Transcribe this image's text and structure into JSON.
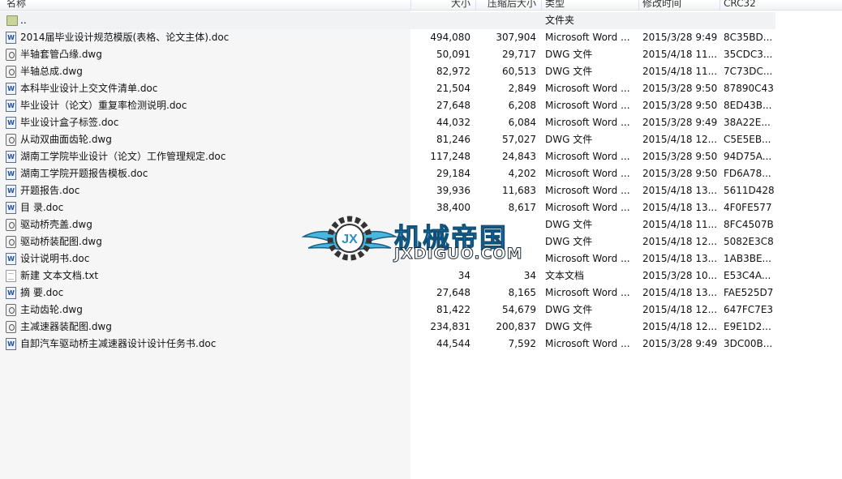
{
  "columns": {
    "name": "名称",
    "size": "大小",
    "packed": "压缩后大小",
    "type": "类型",
    "modified": "修改时间",
    "crc": "CRC32"
  },
  "parent_row": {
    "name": "..",
    "type": "文件夹"
  },
  "files": [
    {
      "icon": "word-doc-icon",
      "name": "2014届毕业设计规范模版(表格、论文主体).doc",
      "size": "494,080",
      "packed": "307,904",
      "type": "Microsoft Word ...",
      "modified": "2015/3/28 9:49",
      "crc": "8C35BD..."
    },
    {
      "icon": "dwg-file-icon",
      "name": "半轴套管凸缘.dwg",
      "size": "50,091",
      "packed": "29,717",
      "type": "DWG 文件",
      "modified": "2015/4/18 11...",
      "crc": "35CDC3..."
    },
    {
      "icon": "dwg-file-icon",
      "name": "半轴总成.dwg",
      "size": "82,972",
      "packed": "60,513",
      "type": "DWG 文件",
      "modified": "2015/4/18 11...",
      "crc": "7C73DC..."
    },
    {
      "icon": "word-doc-icon",
      "name": "本科毕业设计上交文件清单.doc",
      "size": "21,504",
      "packed": "2,849",
      "type": "Microsoft Word ...",
      "modified": "2015/3/28 9:50",
      "crc": "87890C43"
    },
    {
      "icon": "word-doc-icon",
      "name": "毕业设计（论文）重复率检测说明.doc",
      "size": "27,648",
      "packed": "6,208",
      "type": "Microsoft Word ...",
      "modified": "2015/3/28 9:50",
      "crc": "8ED43B..."
    },
    {
      "icon": "word-doc-icon",
      "name": "毕业设计盒子标签.doc",
      "size": "44,032",
      "packed": "6,084",
      "type": "Microsoft Word ...",
      "modified": "2015/3/28 9:49",
      "crc": "38A22E..."
    },
    {
      "icon": "dwg-file-icon",
      "name": "从动双曲面齿轮.dwg",
      "size": "81,246",
      "packed": "57,027",
      "type": "DWG 文件",
      "modified": "2015/4/18 12...",
      "crc": "C5E5EB..."
    },
    {
      "icon": "word-doc-icon",
      "name": "湖南工学院毕业设计（论文）工作管理规定.doc",
      "size": "117,248",
      "packed": "24,843",
      "type": "Microsoft Word ...",
      "modified": "2015/3/28 9:50",
      "crc": "94D75A..."
    },
    {
      "icon": "word-doc-icon",
      "name": "湖南工学院开题报告模板.doc",
      "size": "29,184",
      "packed": "4,202",
      "type": "Microsoft Word ...",
      "modified": "2015/3/28 9:50",
      "crc": "FD6A78..."
    },
    {
      "icon": "word-doc-icon",
      "name": "开题报告.doc",
      "size": "39,936",
      "packed": "11,683",
      "type": "Microsoft Word ...",
      "modified": "2015/4/18 13...",
      "crc": "5611D428"
    },
    {
      "icon": "word-doc-icon",
      "name": "目 录.doc",
      "size": "38,400",
      "packed": "8,617",
      "type": "Microsoft Word ...",
      "modified": "2015/4/18 13...",
      "crc": "4F0FE577"
    },
    {
      "icon": "dwg-file-icon",
      "name": "驱动桥壳盖.dwg",
      "size": "",
      "packed": "",
      "type": "DWG 文件",
      "modified": "2015/4/18 11...",
      "crc": "8FC4507B"
    },
    {
      "icon": "dwg-file-icon",
      "name": "驱动桥装配图.dwg",
      "size": "",
      "packed": "",
      "type": "DWG 文件",
      "modified": "2015/4/18 12...",
      "crc": "5082E3C8"
    },
    {
      "icon": "word-doc-icon",
      "name": "设计说明书.doc",
      "size": "",
      "packed": "",
      "type": "Microsoft Word ...",
      "modified": "2015/4/18 13...",
      "crc": "1AB3BE..."
    },
    {
      "icon": "text-file-icon",
      "name": "新建 文本文档.txt",
      "size": "34",
      "packed": "34",
      "type": "文本文档",
      "modified": "2015/3/28 10...",
      "crc": "E53C4A..."
    },
    {
      "icon": "word-doc-icon",
      "name": "摘 要.doc",
      "size": "27,648",
      "packed": "8,165",
      "type": "Microsoft Word ...",
      "modified": "2015/4/18 13...",
      "crc": "FAE525D7"
    },
    {
      "icon": "dwg-file-icon",
      "name": "主动齿轮.dwg",
      "size": "81,422",
      "packed": "54,679",
      "type": "DWG 文件",
      "modified": "2015/4/18 12...",
      "crc": "647FC7E3"
    },
    {
      "icon": "dwg-file-icon",
      "name": "主减速器装配图.dwg",
      "size": "234,831",
      "packed": "200,837",
      "type": "DWG 文件",
      "modified": "2015/4/18 12...",
      "crc": "E9E1D2..."
    },
    {
      "icon": "word-doc-icon",
      "name": "自卸汽车驱动桥主减速器设计设计任务书.doc",
      "size": "44,544",
      "packed": "7,592",
      "type": "Microsoft Word ...",
      "modified": "2015/3/28 9:49",
      "crc": "3DC00B..."
    }
  ],
  "watermark": {
    "title": "机械帝国",
    "url": "JXDIGUO.COM",
    "emblem": "JX",
    "colors": {
      "title": "#2b8fc7",
      "wings": "#47b6e0",
      "gear": "#333333"
    }
  }
}
